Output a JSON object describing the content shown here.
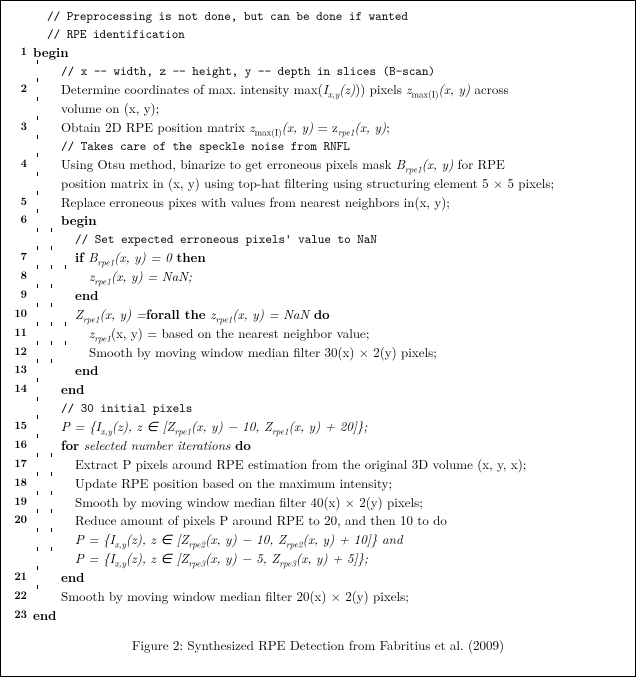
{
  "comments": {
    "pre1": "// Preprocessing is not done, but can be done if wanted",
    "pre2": "// RPE identification",
    "c1": "// x -- width, z -- height, y -- depth in slices (B-scan)",
    "c2": "// Takes care of the speckle noise from RNFL",
    "c3": "// Set expected erroneous pixels' value to NaN",
    "c4": "// 30 initial pixels"
  },
  "kw": {
    "begin": "begin",
    "end": "end",
    "if": "if",
    "then": "then",
    "for": "for",
    "do": "do",
    "forall": "forall the"
  },
  "steps": {
    "s2a": "Determine coordinates of max. intensity max(",
    "s2b": ") pixels ",
    "s2c": " across",
    "s2d": "volume on (x, y);",
    "s3a": "Obtain 2D RPE position matrix ",
    "s3b": ";",
    "s4a": "Using Otsu method, binarize to get erroneous pixels mask ",
    "s4b": " for RPE",
    "s4c": "position matrix in (x, y) using top-hat filtering using structuring element 5 × 5 pixels;",
    "s5": "Replace erroneous pixes with values from nearest neighbors in(x, y);",
    "s7a": " B",
    "s7b": "(x, y) = 0 ",
    "s8": " = NaN;",
    "s10a": "Z",
    "s10b": "(x, y) =",
    "s10c": " z",
    "s10d": "(x, y) = NaN ",
    "s11a": "z",
    "s11b": "(x, y) = based on the nearest neighbor value;",
    "s12": "Smooth by moving window median filter 30(x) × 2(y) pixels;",
    "s15a": "P = {I",
    "s15b": "(z), z ∈ [Z",
    "s15c": "(x, y) − 10, Z",
    "s15d": "(x, y) + 20]};",
    "s16a": " selected number iterations ",
    "s17": "Extract P pixels around RPE estimation from the original 3D volume (x, y, x);",
    "s18": "Update RPE position based on the maximum intensity;",
    "s19": "Smooth by moving window median filter 40(x) × 2(y) pixels;",
    "s20a": "Reduce amount of pixels P around RPE to 20, and then 10 to do",
    "s20b": "P = {I",
    "s20c": "(z), z ∈ [Z",
    "s20d": "(x, y) − 10, Z",
    "s20e": "(x, y) + 10]} and",
    "s20f": "P = {I",
    "s20g": "(z), z ∈ [Z",
    "s20h": "(x, y) − 5, Z",
    "s20i": "(x, y) + 5]};",
    "s22": "Smooth by moving window median filter 20(x) × 2(y) pixels;"
  },
  "math": {
    "Ixyz": "I",
    "xy": "x,y",
    "z": "(z)",
    "zmaxI": "z",
    "maxI": "max(I)",
    "xyarg": "(x, y)",
    "eq3": " = z",
    "rpe1": "rpe1",
    "rpe2": "rpe2",
    "rpe3": "rpe3",
    "Brpe1": "B",
    "zrpe1": "z"
  },
  "caption": "Figure 2: Synthesized RPE Detection from Fabritius et al. (2009)",
  "chart_data": {
    "type": "table",
    "title": "Algorithm pseudocode — Synthesized RPE Detection (Fabritius et al. 2009)",
    "lines": [
      {
        "n": null,
        "text": "// Preprocessing is not done, but can be done if wanted"
      },
      {
        "n": null,
        "text": "// RPE identification"
      },
      {
        "n": 1,
        "text": "begin"
      },
      {
        "n": null,
        "text": "// x -- width, z -- height, y -- depth in slices (B-scan)"
      },
      {
        "n": 2,
        "text": "Determine coordinates of max. intensity max(I_{x,y}(z)) pixels z_{max(I)}(x,y) across volume on (x,y);"
      },
      {
        "n": 3,
        "text": "Obtain 2D RPE position matrix z_{max(I)}(x,y) = z_{rpe1}(x,y);"
      },
      {
        "n": null,
        "text": "// Takes care of the speckle noise from RNFL"
      },
      {
        "n": 4,
        "text": "Using Otsu method, binarize to get erroneous pixels mask B_{rpe1}(x,y) for RPE position matrix in (x,y) using top-hat filtering using structuring element 5×5 pixels;"
      },
      {
        "n": 5,
        "text": "Replace erroneous pixes with values from nearest neighbors in(x,y);"
      },
      {
        "n": 6,
        "text": "begin"
      },
      {
        "n": null,
        "text": "// Set expected erroneous pixels' value to NaN"
      },
      {
        "n": 7,
        "text": "if B_{rpe1}(x,y) = 0 then"
      },
      {
        "n": 8,
        "text": "z_{rpe1}(x,y) = NaN;"
      },
      {
        "n": 9,
        "text": "end"
      },
      {
        "n": 10,
        "text": "Z_{rpe1}(x,y) = forall the z_{rpe1}(x,y) = NaN do"
      },
      {
        "n": 11,
        "text": "z_{rpe1}(x,y) = based on the nearest neighbor value;"
      },
      {
        "n": 12,
        "text": "Smooth by moving window median filter 30(x) × 2(y) pixels;"
      },
      {
        "n": 13,
        "text": "end"
      },
      {
        "n": 14,
        "text": "end"
      },
      {
        "n": null,
        "text": "// 30 initial pixels"
      },
      {
        "n": 15,
        "text": "P = {I_{x,y}(z), z ∈ [Z_{rpe1}(x,y) − 10, Z_{rpe1}(x,y) + 20]};"
      },
      {
        "n": 16,
        "text": "for selected number iterations do"
      },
      {
        "n": 17,
        "text": "Extract P pixels around RPE estimation from the original 3D volume (x,y,x);"
      },
      {
        "n": 18,
        "text": "Update RPE position based on the maximum intensity;"
      },
      {
        "n": 19,
        "text": "Smooth by moving window median filter 40(x) × 2(y) pixels;"
      },
      {
        "n": 20,
        "text": "Reduce amount of pixels P around RPE to 20, and then 10 to do  P = {I_{x,y}(z), z ∈ [Z_{rpe2}(x,y) − 10, Z_{rpe2}(x,y) + 10]} and  P = {I_{x,y}(z), z ∈ [Z_{rpe3}(x,y) − 5, Z_{rpe3}(x,y) + 5]};"
      },
      {
        "n": 21,
        "text": "end"
      },
      {
        "n": 22,
        "text": "Smooth by moving window median filter 20(x) × 2(y) pixels;"
      },
      {
        "n": 23,
        "text": "end"
      }
    ]
  }
}
